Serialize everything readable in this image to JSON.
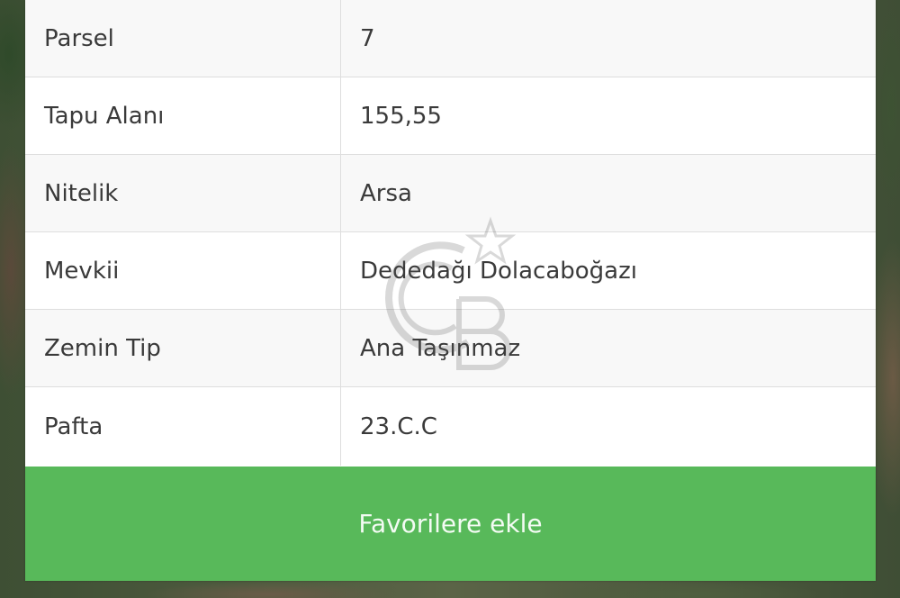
{
  "rows": [
    {
      "key": "Parsel",
      "value": "7"
    },
    {
      "key": "Tapu Alanı",
      "value": "155,55"
    },
    {
      "key": "Nitelik",
      "value": "Arsa"
    },
    {
      "key": "Mevkii",
      "value": "Dededağı Dolacaboğazı"
    },
    {
      "key": "Zemin Tip",
      "value": "Ana Taşınmaz"
    },
    {
      "key": "Pafta",
      "value": "23.C.C"
    }
  ],
  "actions": {
    "favorite_label": "Favorilere ekle"
  },
  "colors": {
    "button_green": "#58b95a",
    "watermark_icon": "coldwell-banker-logo-icon"
  }
}
